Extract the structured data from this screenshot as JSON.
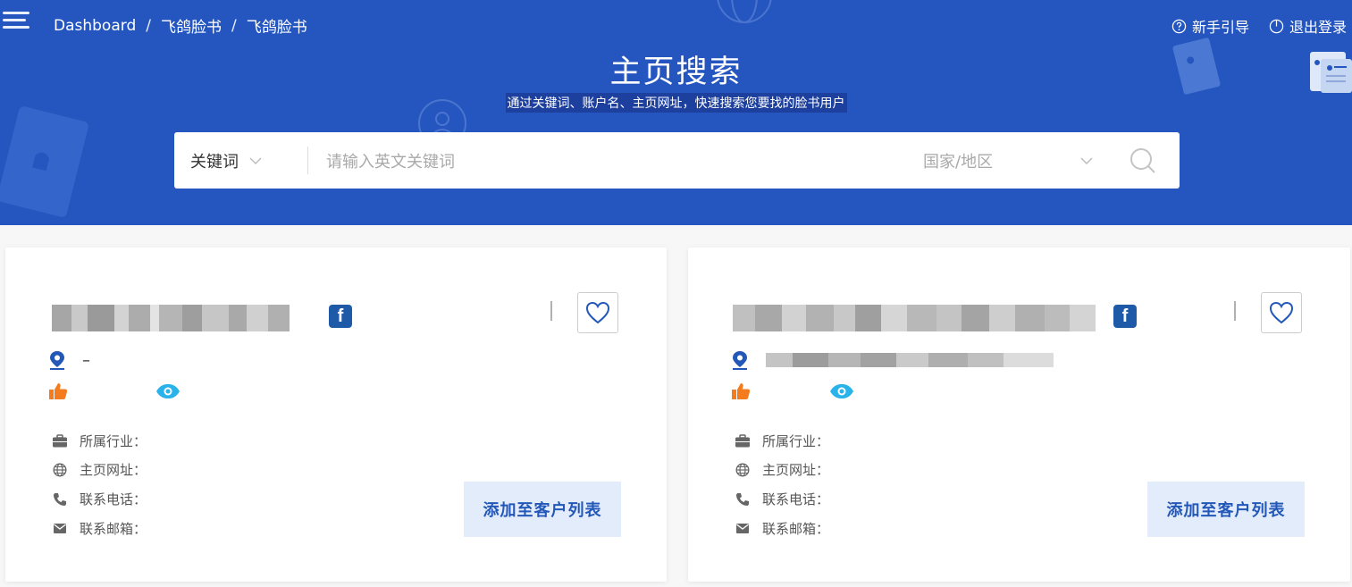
{
  "header": {
    "breadcrumb": [
      "Dashboard",
      "飞鸽脸书",
      "飞鸽脸书"
    ],
    "guide_label": "新手引导",
    "logout_label": "退出登录",
    "title": "主页搜索",
    "subtitle": "通过关键词、账户名、主页网址，快速搜索您要找的脸书用户"
  },
  "search": {
    "type_label": "关键词",
    "placeholder": "请输入英文关键词",
    "region_placeholder": "国家/地区"
  },
  "cards": [
    {
      "location": "–",
      "industry_label": "所属行业：",
      "website_label": "主页网址：",
      "phone_label": "联系电话：",
      "email_label": "联系邮箱：",
      "add_button": "添加至客户列表",
      "platform_badge": "f"
    },
    {
      "location": "",
      "industry_label": "所属行业：",
      "website_label": "主页网址：",
      "phone_label": "联系电话：",
      "email_label": "联系邮箱：",
      "add_button": "添加至客户列表",
      "platform_badge": "f"
    }
  ],
  "colors": {
    "banner": "#2556c0",
    "accent": "#2458b8",
    "like_icon": "#f57b1f",
    "view_icon": "#29b3ea",
    "facebook": "#1e5aa8"
  }
}
